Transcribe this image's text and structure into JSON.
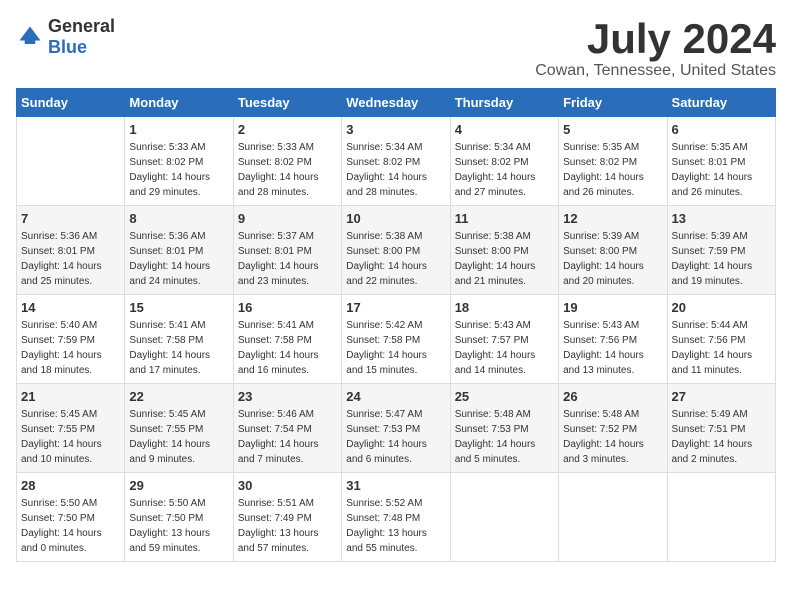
{
  "logo": {
    "text_general": "General",
    "text_blue": "Blue"
  },
  "title": "July 2024",
  "subtitle": "Cowan, Tennessee, United States",
  "days_of_week": [
    "Sunday",
    "Monday",
    "Tuesday",
    "Wednesday",
    "Thursday",
    "Friday",
    "Saturday"
  ],
  "weeks": [
    [
      {
        "day": "",
        "info": ""
      },
      {
        "day": "1",
        "info": "Sunrise: 5:33 AM\nSunset: 8:02 PM\nDaylight: 14 hours\nand 29 minutes."
      },
      {
        "day": "2",
        "info": "Sunrise: 5:33 AM\nSunset: 8:02 PM\nDaylight: 14 hours\nand 28 minutes."
      },
      {
        "day": "3",
        "info": "Sunrise: 5:34 AM\nSunset: 8:02 PM\nDaylight: 14 hours\nand 28 minutes."
      },
      {
        "day": "4",
        "info": "Sunrise: 5:34 AM\nSunset: 8:02 PM\nDaylight: 14 hours\nand 27 minutes."
      },
      {
        "day": "5",
        "info": "Sunrise: 5:35 AM\nSunset: 8:02 PM\nDaylight: 14 hours\nand 26 minutes."
      },
      {
        "day": "6",
        "info": "Sunrise: 5:35 AM\nSunset: 8:01 PM\nDaylight: 14 hours\nand 26 minutes."
      }
    ],
    [
      {
        "day": "7",
        "info": "Sunrise: 5:36 AM\nSunset: 8:01 PM\nDaylight: 14 hours\nand 25 minutes."
      },
      {
        "day": "8",
        "info": "Sunrise: 5:36 AM\nSunset: 8:01 PM\nDaylight: 14 hours\nand 24 minutes."
      },
      {
        "day": "9",
        "info": "Sunrise: 5:37 AM\nSunset: 8:01 PM\nDaylight: 14 hours\nand 23 minutes."
      },
      {
        "day": "10",
        "info": "Sunrise: 5:38 AM\nSunset: 8:00 PM\nDaylight: 14 hours\nand 22 minutes."
      },
      {
        "day": "11",
        "info": "Sunrise: 5:38 AM\nSunset: 8:00 PM\nDaylight: 14 hours\nand 21 minutes."
      },
      {
        "day": "12",
        "info": "Sunrise: 5:39 AM\nSunset: 8:00 PM\nDaylight: 14 hours\nand 20 minutes."
      },
      {
        "day": "13",
        "info": "Sunrise: 5:39 AM\nSunset: 7:59 PM\nDaylight: 14 hours\nand 19 minutes."
      }
    ],
    [
      {
        "day": "14",
        "info": "Sunrise: 5:40 AM\nSunset: 7:59 PM\nDaylight: 14 hours\nand 18 minutes."
      },
      {
        "day": "15",
        "info": "Sunrise: 5:41 AM\nSunset: 7:58 PM\nDaylight: 14 hours\nand 17 minutes."
      },
      {
        "day": "16",
        "info": "Sunrise: 5:41 AM\nSunset: 7:58 PM\nDaylight: 14 hours\nand 16 minutes."
      },
      {
        "day": "17",
        "info": "Sunrise: 5:42 AM\nSunset: 7:58 PM\nDaylight: 14 hours\nand 15 minutes."
      },
      {
        "day": "18",
        "info": "Sunrise: 5:43 AM\nSunset: 7:57 PM\nDaylight: 14 hours\nand 14 minutes."
      },
      {
        "day": "19",
        "info": "Sunrise: 5:43 AM\nSunset: 7:56 PM\nDaylight: 14 hours\nand 13 minutes."
      },
      {
        "day": "20",
        "info": "Sunrise: 5:44 AM\nSunset: 7:56 PM\nDaylight: 14 hours\nand 11 minutes."
      }
    ],
    [
      {
        "day": "21",
        "info": "Sunrise: 5:45 AM\nSunset: 7:55 PM\nDaylight: 14 hours\nand 10 minutes."
      },
      {
        "day": "22",
        "info": "Sunrise: 5:45 AM\nSunset: 7:55 PM\nDaylight: 14 hours\nand 9 minutes."
      },
      {
        "day": "23",
        "info": "Sunrise: 5:46 AM\nSunset: 7:54 PM\nDaylight: 14 hours\nand 7 minutes."
      },
      {
        "day": "24",
        "info": "Sunrise: 5:47 AM\nSunset: 7:53 PM\nDaylight: 14 hours\nand 6 minutes."
      },
      {
        "day": "25",
        "info": "Sunrise: 5:48 AM\nSunset: 7:53 PM\nDaylight: 14 hours\nand 5 minutes."
      },
      {
        "day": "26",
        "info": "Sunrise: 5:48 AM\nSunset: 7:52 PM\nDaylight: 14 hours\nand 3 minutes."
      },
      {
        "day": "27",
        "info": "Sunrise: 5:49 AM\nSunset: 7:51 PM\nDaylight: 14 hours\nand 2 minutes."
      }
    ],
    [
      {
        "day": "28",
        "info": "Sunrise: 5:50 AM\nSunset: 7:50 PM\nDaylight: 14 hours\nand 0 minutes."
      },
      {
        "day": "29",
        "info": "Sunrise: 5:50 AM\nSunset: 7:50 PM\nDaylight: 13 hours\nand 59 minutes."
      },
      {
        "day": "30",
        "info": "Sunrise: 5:51 AM\nSunset: 7:49 PM\nDaylight: 13 hours\nand 57 minutes."
      },
      {
        "day": "31",
        "info": "Sunrise: 5:52 AM\nSunset: 7:48 PM\nDaylight: 13 hours\nand 55 minutes."
      },
      {
        "day": "",
        "info": ""
      },
      {
        "day": "",
        "info": ""
      },
      {
        "day": "",
        "info": ""
      }
    ]
  ]
}
